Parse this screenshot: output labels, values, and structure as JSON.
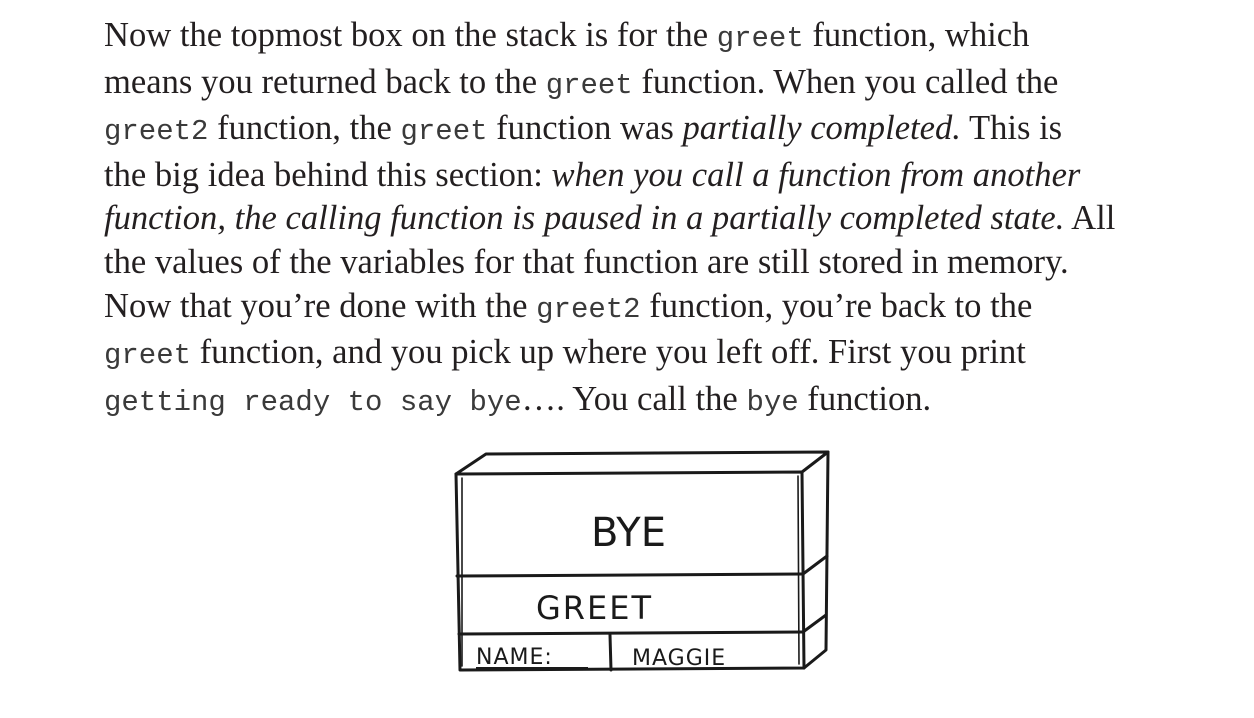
{
  "paragraph": {
    "l1_a": "Now the topmost box on the stack is for the ",
    "l1_code": "greet",
    "l1_b": " function, which",
    "l2_a": "means you returned back to the ",
    "l2_code": "greet",
    "l2_b": " function. When you called the",
    "l3_code1": "greet2",
    "l3_a": " function, the ",
    "l3_code2": "greet",
    "l3_b": " function was ",
    "l3_ital": "partially completed.",
    "l3_c": " This is",
    "l4_a": "the big idea behind this section: ",
    "l4_ital": "when you call a function from another",
    "l5_ital": "function, the calling function is paused in a partially completed state.",
    "l5_a": " All",
    "l6": "the values of the variables for that function are still stored in memory.",
    "l7_a": "Now that you’re done with the ",
    "l7_code": "greet2",
    "l7_b": " function, you’re back to the",
    "l8_code": "greet",
    "l8_a": " function, and you pick up where you left off. First you print",
    "l9_code1": "getting ready to say bye",
    "l9_a": "…. You call the ",
    "l9_code2": "bye",
    "l9_b": " function."
  },
  "stack_figure": {
    "top_frame": "BYE",
    "second_frame": "GREET",
    "var_name": "NAME:",
    "var_value": "MAGGIE"
  }
}
